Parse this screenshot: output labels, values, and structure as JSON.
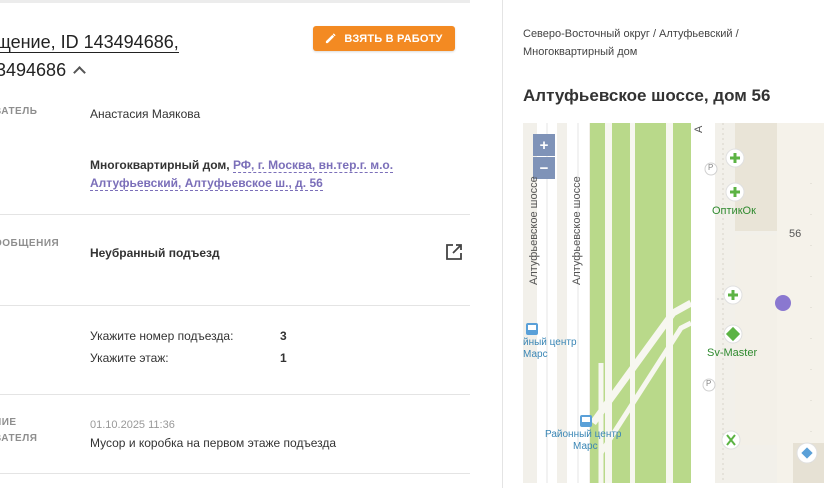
{
  "header": {
    "title_line1": "щение, ID 143494686,",
    "title_line2": "3494686",
    "take_button": "ВЗЯТЬ В РАБОТУ"
  },
  "details": {
    "author_label": "ВАТЕЛЬ",
    "author_name": "Анастасия Маякова",
    "object_type": "Многоквартирный дом,",
    "object_address_1": "РФ, г. Москва, вн.тер.г. м.о.",
    "object_address_2": "Алтуфьевский, Алтуфьевское ш., д. 56",
    "message_label": "ООБЩЕНИЯ",
    "message_topic": "Неубранный подъезд",
    "entrance_label": "Укажите номер подъезда:",
    "entrance_value": "3",
    "floor_label": "Укажите этаж:",
    "floor_value": "1",
    "desc_label_1": "НИЕ",
    "desc_label_2": "ВАТЕЛЯ",
    "desc_date": "01.10.2025 11:36",
    "desc_text": "Мусор и коробка на первом этаже подъезда"
  },
  "location": {
    "breadcrumb_1": "Северо-Восточный округ / Алтуфьевский /",
    "breadcrumb_2": "Многоквартирный дом",
    "address": "Алтуфьевское шоссе, дом 56"
  },
  "map": {
    "zoom_in": "+",
    "zoom_out": "−",
    "street_1": "Алтуфьевское шоссе",
    "street_2": "Алтуфьевское шоссе",
    "street_3": "А",
    "poi_optik": "ОптикОк",
    "poi_svmaster": "Sv-Master",
    "house_number": "56",
    "bus_stop_1a": "йный центр",
    "bus_stop_1b": "Марс",
    "bus_stop_2a": "Районный центр",
    "bus_stop_2b": "Марс",
    "parking_1": "P",
    "parking_2": "P",
    "colors": {
      "green_strip": "#b9d98a",
      "road": "#ffffff",
      "building": "#ece7db",
      "marker": "#8a78d0",
      "poi": "#5cb344"
    }
  },
  "colors": {
    "accent": "#f38a22",
    "link": "#7b6fb9"
  }
}
